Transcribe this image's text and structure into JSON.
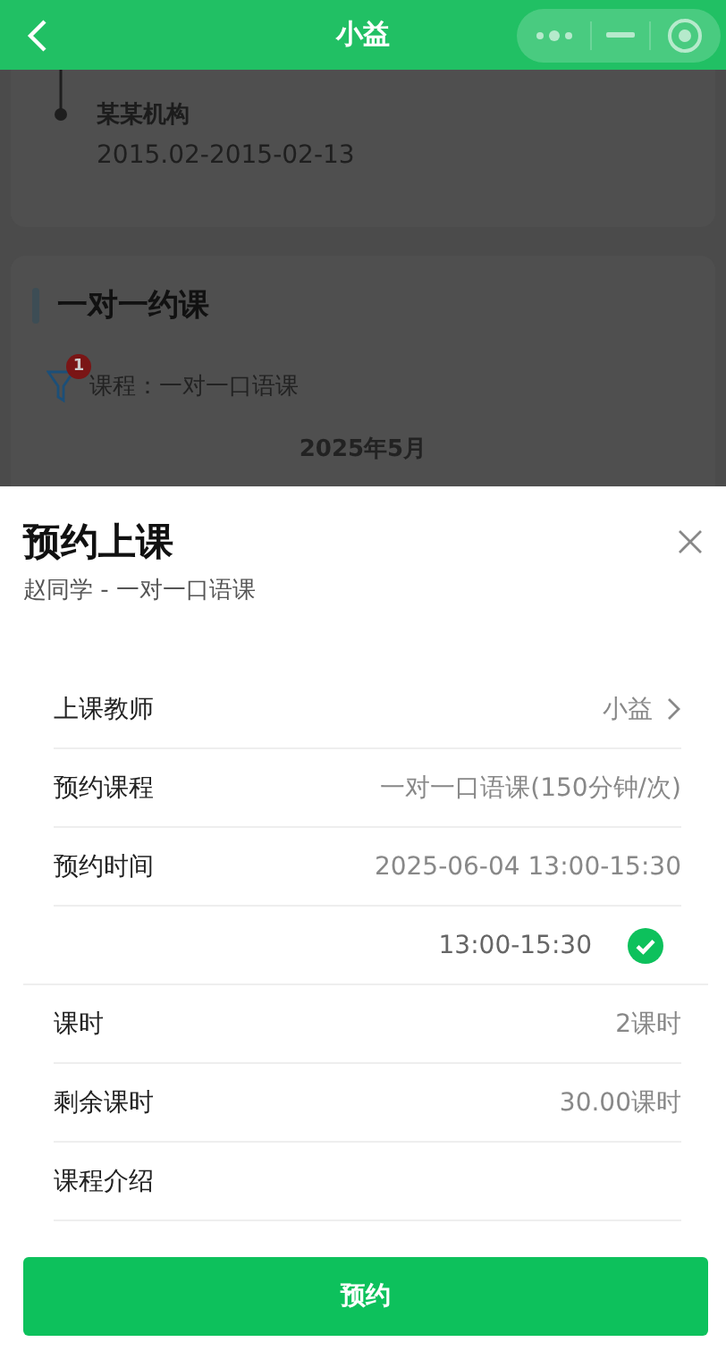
{
  "header": {
    "title": "小益"
  },
  "background": {
    "org": "某某机构",
    "period": "2015.02-2015-02-13",
    "section_title": "一对一约课",
    "filter_count": "1",
    "filter_text": "课程：一对一口语课",
    "month": "2025年5月"
  },
  "sheet": {
    "title": "预约上课",
    "subtitle": "赵同学 - 一对一口语课",
    "rows": [
      {
        "kind": "info",
        "label": "上课教师",
        "value": "小益",
        "link": true
      },
      {
        "kind": "info",
        "label": "预约课程",
        "value": "一对一口语课(150分钟/次)",
        "link": false
      },
      {
        "kind": "info",
        "label": "预约时间",
        "value": "2025-06-04 13:00-15:30",
        "link": false
      },
      {
        "kind": "slot",
        "value": "13:00-15:30",
        "selected": true
      },
      {
        "kind": "info",
        "label": "课时",
        "value": "2课时",
        "link": false
      },
      {
        "kind": "info",
        "label": "剩余课时",
        "value": "30.00课时",
        "link": false
      },
      {
        "kind": "info",
        "label": "课程介绍",
        "link": false
      }
    ],
    "button": "预约"
  }
}
